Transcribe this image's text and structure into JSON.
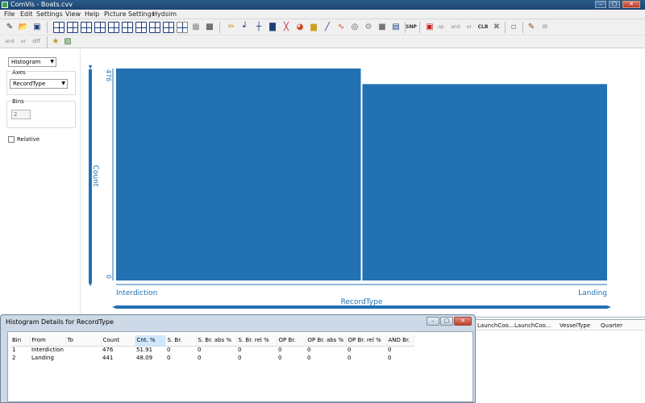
{
  "window": {
    "title": "ComVis - Boats.cvv",
    "controls": [
      "–",
      "▢",
      "✕"
    ]
  },
  "menu": [
    "File",
    "Edit",
    "Settings",
    "View",
    "Help",
    "Picture Settings",
    "Hydsim"
  ],
  "toolbar": {
    "row1_text_buttons": [
      "SNP",
      "op",
      "and",
      "or",
      "CLB"
    ],
    "row2_text_buttons": [
      "and",
      "or",
      "diff"
    ]
  },
  "left_panel": {
    "view_type": "Histogram",
    "axes_label": "Axes",
    "axes_value": "RecordType",
    "bins_label": "Bins",
    "bins_value": "2",
    "relative_label": "Relative"
  },
  "colors": {
    "bar": "#2271b3",
    "axis": "#2271b3",
    "title_bar": "#1d4470"
  },
  "chart_data": {
    "type": "bar",
    "categories": [
      "Interdiction",
      "Landing"
    ],
    "values": [
      476,
      441
    ],
    "xlabel": "RecordType",
    "ylabel": "Count",
    "ylim": [
      0,
      476
    ],
    "y_tick_labels": [
      "476",
      "0"
    ],
    "x_tick_labels": [
      "Interdiction",
      "Landing"
    ],
    "grid": false,
    "legend": "none"
  },
  "background_table_headers": [
    "LaunchCoo...",
    "LaunchCoo...",
    "VesselType",
    "Quarter"
  ],
  "dialog": {
    "title": "Histogram Details for RecordType",
    "controls": [
      "–",
      "▢",
      "✕"
    ],
    "columns": [
      "Bin",
      "From",
      "To",
      "Count",
      "Cnt. %",
      "S. Br.",
      "S. Br. abs %",
      "S. Br. rel %",
      "OP Br.",
      "OP Br. abs %",
      "OP Br. rel %",
      "AND Br."
    ],
    "selected_column": "Cnt. %",
    "rows": [
      [
        "1",
        "Interdiction",
        "",
        "476",
        "51.91",
        "0",
        "0",
        "0",
        "0",
        "0",
        "0",
        "0"
      ],
      [
        "2",
        "Landing",
        "",
        "441",
        "48.09",
        "0",
        "0",
        "0",
        "0",
        "0",
        "0",
        "0"
      ]
    ]
  }
}
